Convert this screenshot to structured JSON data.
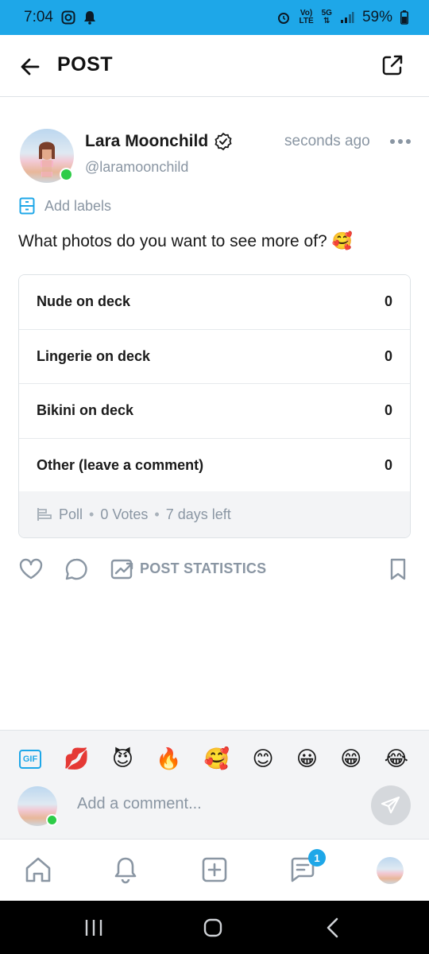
{
  "status_bar": {
    "time": "7:04",
    "lte_top": "Vo)",
    "lte_bottom": "LTE",
    "net_top": "5G",
    "battery": "59%"
  },
  "header": {
    "title": "POST"
  },
  "post": {
    "author_name": "Lara Moonchild",
    "author_handle": "@laramoonchild",
    "time": "seconds ago",
    "add_labels": "Add labels",
    "text": "What photos do you want to see more of? 🥰"
  },
  "poll": {
    "options": [
      {
        "label": "Nude on deck",
        "votes": "0"
      },
      {
        "label": "Lingerie on deck",
        "votes": "0"
      },
      {
        "label": "Bikini on deck",
        "votes": "0"
      },
      {
        "label": "Other (leave a comment)",
        "votes": "0"
      }
    ],
    "type_label": "Poll",
    "votes_label": "0 Votes",
    "time_left": "7 days left"
  },
  "actions": {
    "stats_label": "POST STATISTICS"
  },
  "comment": {
    "gif_label": "GIF",
    "emojis": [
      "💋",
      "😈",
      "🔥",
      "🥰",
      "😊",
      "😀",
      "😁",
      "😂"
    ],
    "placeholder": "Add a comment..."
  },
  "nav": {
    "messages_badge": "1"
  },
  "colors": {
    "accent": "#1ea7e8",
    "muted_text": "#8a96a3",
    "online": "#2ecc48"
  }
}
